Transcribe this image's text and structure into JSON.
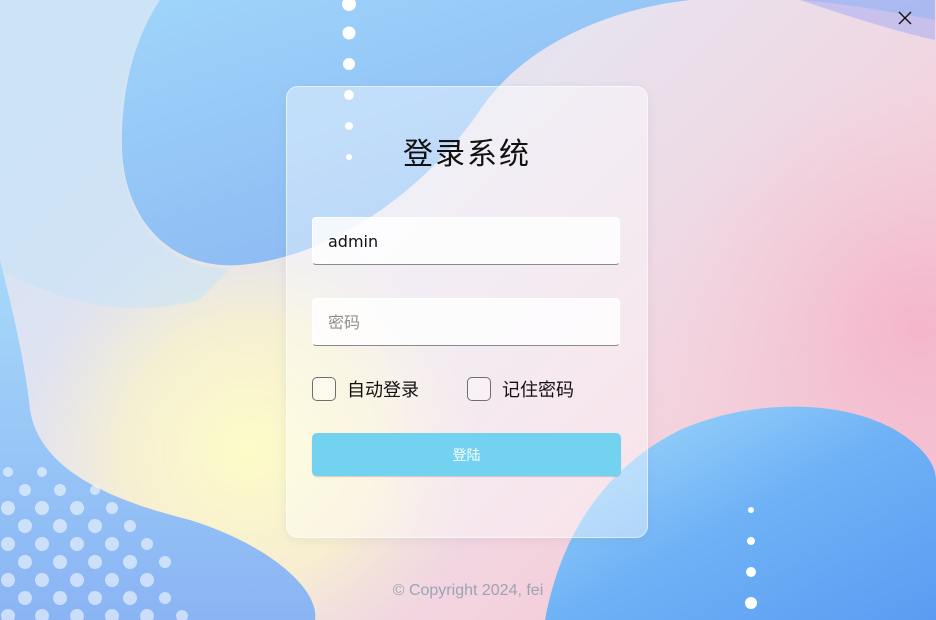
{
  "window": {
    "close_icon": "close-icon"
  },
  "login": {
    "title": "登录系统",
    "username_value": "admin",
    "password_placeholder": "密码",
    "auto_login_label": "自动登录",
    "remember_password_label": "记住密码",
    "submit_label": "登陆"
  },
  "footer": {
    "copyright": "© Copyright 2024, fei"
  },
  "colors": {
    "accent": "#72d2f0",
    "blob_blue": "#8ec4f6",
    "blob_pink": "#f4b9cc",
    "blob_yellow": "#fcf7c4"
  }
}
